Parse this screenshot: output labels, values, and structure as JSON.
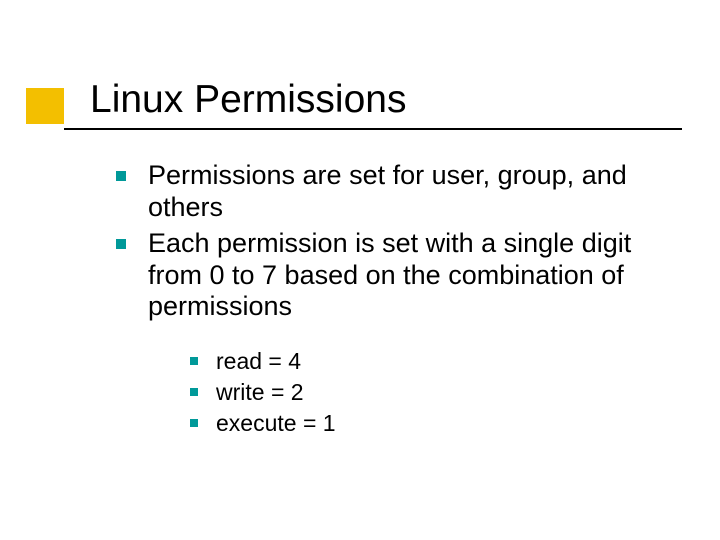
{
  "title": "Linux Permissions",
  "bullets": {
    "item0": "Permissions are set for user, group, and others",
    "item1": "Each permission is set with a single digit from 0 to 7 based on the combination of permissions",
    "sub0": "read = 4",
    "sub1": "write = 2",
    "sub2": "execute = 1"
  }
}
